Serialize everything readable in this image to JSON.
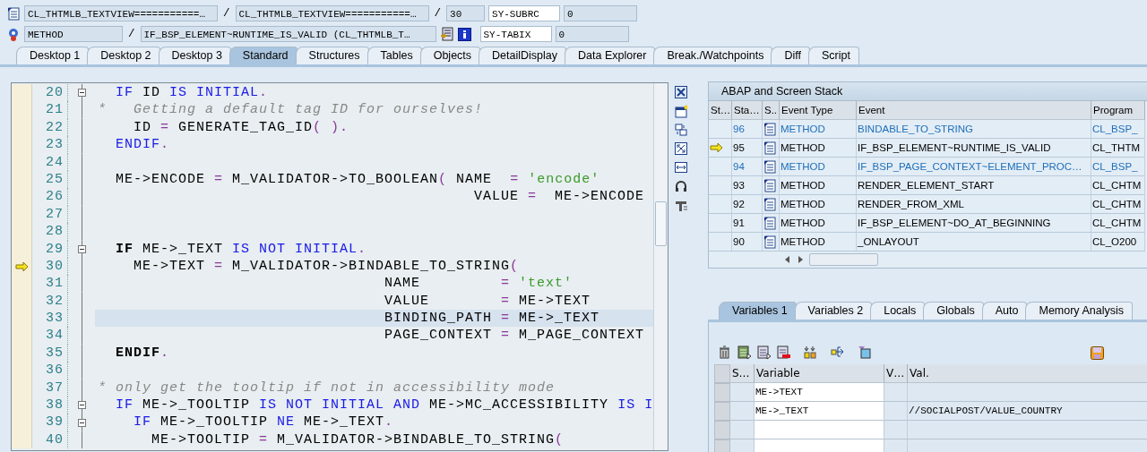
{
  "header": {
    "row1": {
      "class_field": "CL_THTMLB_TEXTVIEW===========…",
      "include_field": "CL_THTMLB_TEXTVIEW===========…",
      "line_field": "30",
      "sys_label": "SY-SUBRC",
      "sys_value": "0"
    },
    "row2": {
      "type_field": "METHOD",
      "method_field": "IF_BSP_ELEMENT~RUNTIME_IS_VALID (CL_THTMLB_T…",
      "sys_label": "SY-TABIX",
      "sys_value": "0"
    },
    "separator": "/"
  },
  "tabs": [
    {
      "label": "Desktop 1",
      "selected": false
    },
    {
      "label": "Desktop 2",
      "selected": false
    },
    {
      "label": "Desktop 3",
      "selected": false
    },
    {
      "label": "Standard",
      "selected": true
    },
    {
      "label": "Structures",
      "selected": false
    },
    {
      "label": "Tables",
      "selected": false
    },
    {
      "label": "Objects",
      "selected": false
    },
    {
      "label": "DetailDisplay",
      "selected": false
    },
    {
      "label": "Data Explorer",
      "selected": false
    },
    {
      "label": "Break./Watchpoints",
      "selected": false
    },
    {
      "label": "Diff",
      "selected": false
    },
    {
      "label": "Script",
      "selected": false
    }
  ],
  "editor": {
    "lines": [
      {
        "num": "20",
        "foldable": true,
        "current": false,
        "highlighted": false,
        "segments": [
          {
            "kind": "kw",
            "text": "  IF"
          },
          {
            "kind": "plain",
            "text": " ID "
          },
          {
            "kind": "kw",
            "text": "IS INITIAL"
          },
          {
            "kind": "punct",
            "text": "."
          }
        ]
      },
      {
        "num": "21",
        "foldable": false,
        "current": false,
        "highlighted": false,
        "segments": [
          {
            "kind": "comment",
            "text": "*   Getting a default tag ID for ourselves!"
          }
        ]
      },
      {
        "num": "22",
        "foldable": false,
        "current": false,
        "highlighted": false,
        "segments": [
          {
            "kind": "plain",
            "text": "    ID "
          },
          {
            "kind": "punct",
            "text": "="
          },
          {
            "kind": "plain",
            "text": " GENERATE_TAG_ID"
          },
          {
            "kind": "punct",
            "text": "( )."
          }
        ]
      },
      {
        "num": "23",
        "foldable": false,
        "current": false,
        "highlighted": false,
        "segments": [
          {
            "kind": "kw",
            "text": "  ENDIF"
          },
          {
            "kind": "punct",
            "text": "."
          }
        ]
      },
      {
        "num": "24",
        "foldable": false,
        "current": false,
        "highlighted": false
      },
      {
        "num": "25",
        "foldable": false,
        "current": false,
        "highlighted": false,
        "segments": [
          {
            "kind": "plain",
            "text": "  ME->ENCODE "
          },
          {
            "kind": "punct",
            "text": "="
          },
          {
            "kind": "plain",
            "text": " M_VALIDATOR->TO_BOOLEAN"
          },
          {
            "kind": "punct",
            "text": "("
          },
          {
            "kind": "plain",
            "text": " NAME  "
          },
          {
            "kind": "punct",
            "text": "= "
          },
          {
            "kind": "str",
            "text": "'encode'"
          }
        ]
      },
      {
        "num": "26",
        "foldable": false,
        "current": false,
        "highlighted": false,
        "segments": [
          {
            "kind": "plain",
            "text": "                                          VALUE "
          },
          {
            "kind": "punct",
            "text": "="
          },
          {
            "kind": "plain",
            "text": "  ME->ENCODE"
          }
        ]
      },
      {
        "num": "27",
        "foldable": false,
        "current": false,
        "highlighted": false
      },
      {
        "num": "28",
        "foldable": false,
        "current": false,
        "highlighted": false
      },
      {
        "num": "29",
        "foldable": true,
        "current": false,
        "highlighted": false,
        "segments": [
          {
            "kind": "bold",
            "text": "  IF"
          },
          {
            "kind": "plain",
            "text": " ME->_TEXT "
          },
          {
            "kind": "kw",
            "text": "IS NOT INITIAL"
          },
          {
            "kind": "punct",
            "text": "."
          }
        ]
      },
      {
        "num": "30",
        "foldable": false,
        "current": true,
        "highlighted": false,
        "segments": [
          {
            "kind": "plain",
            "text": "    ME->TEXT "
          },
          {
            "kind": "punct",
            "text": "="
          },
          {
            "kind": "plain",
            "text": " M_VALIDATOR->BINDABLE_TO_STRING"
          },
          {
            "kind": "punct",
            "text": "("
          }
        ]
      },
      {
        "num": "31",
        "foldable": false,
        "current": false,
        "highlighted": false,
        "segments": [
          {
            "kind": "plain",
            "text": "                                NAME         "
          },
          {
            "kind": "punct",
            "text": "= "
          },
          {
            "kind": "str",
            "text": "'text'"
          }
        ]
      },
      {
        "num": "32",
        "foldable": false,
        "current": false,
        "highlighted": false,
        "segments": [
          {
            "kind": "plain",
            "text": "                                VALUE        "
          },
          {
            "kind": "punct",
            "text": "="
          },
          {
            "kind": "plain",
            "text": " ME->TEXT"
          }
        ]
      },
      {
        "num": "33",
        "foldable": false,
        "current": false,
        "highlighted": true,
        "segments": [
          {
            "kind": "plain",
            "text": "                                BINDING_PATH "
          },
          {
            "kind": "punct",
            "text": "="
          },
          {
            "kind": "plain",
            "text": " ME->_TEXT"
          }
        ]
      },
      {
        "num": "34",
        "foldable": false,
        "current": false,
        "highlighted": false,
        "segments": [
          {
            "kind": "plain",
            "text": "                                PAGE_CONTEXT "
          },
          {
            "kind": "punct",
            "text": "="
          },
          {
            "kind": "plain",
            "text": " M_PAGE_CONTEXT"
          }
        ]
      },
      {
        "num": "35",
        "foldable": false,
        "current": false,
        "highlighted": false,
        "segments": [
          {
            "kind": "bold",
            "text": "  ENDIF"
          },
          {
            "kind": "punct",
            "text": "."
          }
        ]
      },
      {
        "num": "36",
        "foldable": false,
        "current": false,
        "highlighted": false
      },
      {
        "num": "37",
        "foldable": false,
        "current": false,
        "highlighted": false,
        "segments": [
          {
            "kind": "comment",
            "text": "* only get the tooltip if not in accessibility mode"
          }
        ]
      },
      {
        "num": "38",
        "foldable": true,
        "current": false,
        "highlighted": false,
        "segments": [
          {
            "kind": "kw",
            "text": "  IF"
          },
          {
            "kind": "plain",
            "text": " ME->_TOOLTIP "
          },
          {
            "kind": "kw",
            "text": "IS NOT INITIAL AND"
          },
          {
            "kind": "plain",
            "text": " ME->MC_ACCESSIBILITY "
          },
          {
            "kind": "kw",
            "text": "IS I"
          }
        ]
      },
      {
        "num": "39",
        "foldable": true,
        "current": false,
        "highlighted": false,
        "segments": [
          {
            "kind": "kw",
            "text": "    IF"
          },
          {
            "kind": "plain",
            "text": " ME->_TOOLTIP "
          },
          {
            "kind": "kw",
            "text": "NE"
          },
          {
            "kind": "plain",
            "text": " ME->_TEXT"
          },
          {
            "kind": "punct",
            "text": "."
          }
        ]
      },
      {
        "num": "40",
        "foldable": false,
        "current": false,
        "highlighted": false,
        "segments": [
          {
            "kind": "plain",
            "text": "      ME->TOOLTIP "
          },
          {
            "kind": "punct",
            "text": "="
          },
          {
            "kind": "plain",
            "text": " M_VALIDATOR->BINDABLE_TO_STRING"
          },
          {
            "kind": "punct",
            "text": "("
          }
        ]
      }
    ]
  },
  "stack": {
    "title": "ABAP and Screen Stack",
    "columns": [
      "St…",
      "Sta…",
      "S..",
      "Event Type",
      "Event",
      "Program"
    ],
    "rows": [
      {
        "current": false,
        "emphasis": true,
        "level": "96",
        "event_type": "METHOD",
        "event": "BINDABLE_TO_STRING",
        "program": "CL_BSP_"
      },
      {
        "current": true,
        "emphasis": false,
        "level": "95",
        "event_type": "METHOD",
        "event": "IF_BSP_ELEMENT~RUNTIME_IS_VALID",
        "program": "CL_THTM"
      },
      {
        "current": false,
        "emphasis": true,
        "level": "94",
        "event_type": "METHOD",
        "event": "IF_BSP_PAGE_CONTEXT~ELEMENT_PROC…",
        "program": "CL_BSP_"
      },
      {
        "current": false,
        "emphasis": false,
        "level": "93",
        "event_type": "METHOD",
        "event": "RENDER_ELEMENT_START",
        "program": "CL_CHTM"
      },
      {
        "current": false,
        "emphasis": false,
        "level": "92",
        "event_type": "METHOD",
        "event": "RENDER_FROM_XML",
        "program": "CL_CHTM"
      },
      {
        "current": false,
        "emphasis": false,
        "level": "91",
        "event_type": "METHOD",
        "event": "IF_BSP_ELEMENT~DO_AT_BEGINNING",
        "program": "CL_CHTM"
      },
      {
        "current": false,
        "emphasis": false,
        "level": "90",
        "event_type": "METHOD",
        "event": "_ONLAYOUT",
        "program": "CL_O200"
      }
    ]
  },
  "variable_tabs": [
    {
      "label": "Variables 1",
      "selected": true
    },
    {
      "label": "Variables 2",
      "selected": false
    },
    {
      "label": "Locals",
      "selected": false
    },
    {
      "label": "Globals",
      "selected": false
    },
    {
      "label": "Auto",
      "selected": false
    },
    {
      "label": "Memory Analysis",
      "selected": false
    }
  ],
  "variables": {
    "columns": [
      "S…",
      "Variable",
      "V…",
      "Val."
    ],
    "rows": [
      {
        "variable": "ME->TEXT"
      },
      {
        "variable": "ME->_TEXT",
        "value": "//SOCIALPOST/VALUE_COUNTRY"
      },
      {},
      {}
    ]
  }
}
